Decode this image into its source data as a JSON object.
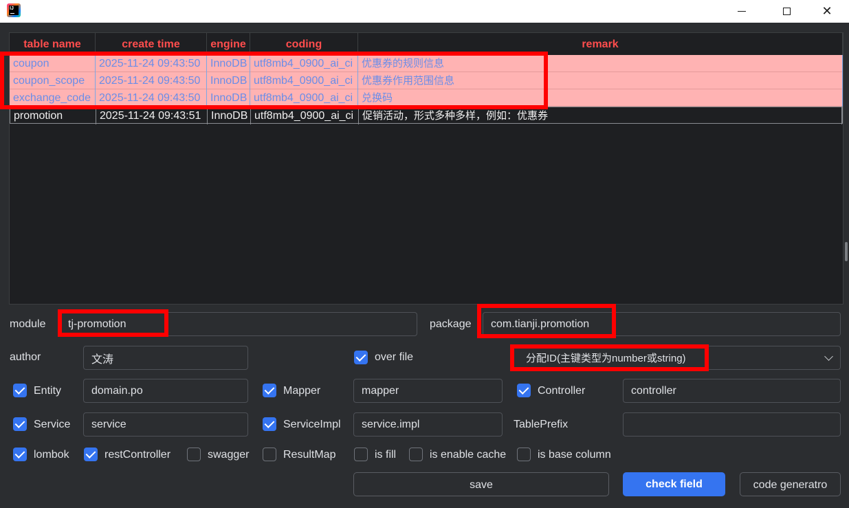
{
  "window": {
    "app_icon_text": "IJ"
  },
  "table": {
    "columns": [
      "table name",
      "create time",
      "engine",
      "coding",
      "remark"
    ],
    "rows": [
      {
        "name": "coupon",
        "create_time": "2025-11-24 09:43:50",
        "engine": "InnoDB",
        "coding": "utf8mb4_0900_ai_ci",
        "remark": "优惠券的规则信息",
        "selected": true
      },
      {
        "name": "coupon_scope",
        "create_time": "2025-11-24 09:43:50",
        "engine": "InnoDB",
        "coding": "utf8mb4_0900_ai_ci",
        "remark": "优惠券作用范围信息",
        "selected": true
      },
      {
        "name": "exchange_code",
        "create_time": "2025-11-24 09:43:50",
        "engine": "InnoDB",
        "coding": "utf8mb4_0900_ai_ci",
        "remark": "兑换码",
        "selected": true
      },
      {
        "name": "promotion",
        "create_time": "2025-11-24 09:43:51",
        "engine": "InnoDB",
        "coding": "utf8mb4_0900_ai_ci",
        "remark": "促销活动，形式多种多样，例如：优惠券",
        "selected": false
      }
    ]
  },
  "form": {
    "module_label": "module",
    "module_value": "tj-promotion",
    "package_label": "package",
    "package_value": "com.tianji.promotion",
    "author_label": "author",
    "author_value": "文涛",
    "over_file_label": "over file",
    "over_file_checked": true,
    "id_type_value": "分配ID(主键类型为number或string)",
    "entity_label": "Entity",
    "entity_value": "domain.po",
    "mapper_label": "Mapper",
    "mapper_value": "mapper",
    "controller_label": "Controller",
    "controller_value": "controller",
    "service_label": "Service",
    "service_value": "service",
    "serviceimpl_label": "ServiceImpl",
    "serviceimpl_value": "service.impl",
    "tableprefix_label": "TablePrefix",
    "tableprefix_value": "",
    "options": {
      "lombok": "lombok",
      "restController": "restController",
      "swagger": "swagger",
      "resultMap": "ResultMap",
      "isFill": "is fill",
      "isEnableCache": "is enable cache",
      "isBaseColumn": "is base column"
    }
  },
  "buttons": {
    "save": "save",
    "check_field": "check field",
    "code_generator": "code generatro"
  },
  "colors": {
    "accent": "#3574f0",
    "header_text": "#ff4d4d",
    "highlight_row": "#ffb3b3",
    "annotation_box": "#ff0000"
  }
}
